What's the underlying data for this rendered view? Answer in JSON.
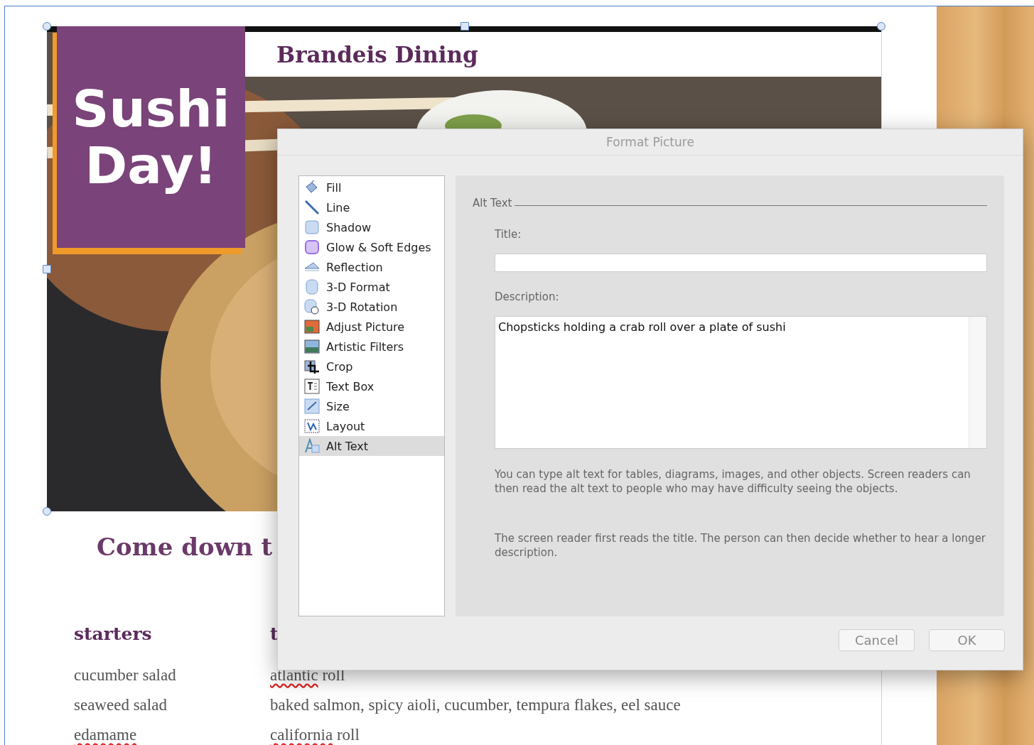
{
  "document": {
    "brand": "Brandeis Dining",
    "badge_lines": [
      "Sushi",
      "Day!"
    ],
    "headline": "Come down t",
    "columns": [
      {
        "heading": "starters",
        "items": [
          [
            {
              "text": "cucumber salad",
              "misspelled": false
            }
          ],
          [
            {
              "text": "seaweed salad",
              "misspelled": false
            }
          ],
          [
            {
              "text": "edamame",
              "misspelled": true
            }
          ]
        ]
      },
      {
        "heading": "t",
        "items": [
          [
            {
              "text": "atlantic",
              "misspelled": true
            },
            {
              "text": " roll",
              "misspelled": false
            }
          ],
          [
            {
              "text": "baked salmon, spicy aioli, cucumber, tempura flakes, eel sauce",
              "misspelled": false
            }
          ],
          [
            {
              "text": "california",
              "misspelled": true
            },
            {
              "text": " roll",
              "misspelled": false
            }
          ]
        ]
      }
    ]
  },
  "dialog": {
    "title": "Format Picture",
    "categories": [
      {
        "label": "Fill",
        "selected": false
      },
      {
        "label": "Line",
        "selected": false
      },
      {
        "label": "Shadow",
        "selected": false
      },
      {
        "label": "Glow & Soft Edges",
        "selected": false
      },
      {
        "label": "Reflection",
        "selected": false
      },
      {
        "label": "3-D Format",
        "selected": false
      },
      {
        "label": "3-D Rotation",
        "selected": false
      },
      {
        "label": "Adjust Picture",
        "selected": false
      },
      {
        "label": "Artistic Filters",
        "selected": false
      },
      {
        "label": "Crop",
        "selected": false
      },
      {
        "label": "Text Box",
        "selected": false
      },
      {
        "label": "Size",
        "selected": false
      },
      {
        "label": "Layout",
        "selected": false
      },
      {
        "label": "Alt Text",
        "selected": true
      }
    ],
    "section_label": "Alt Text",
    "title_label": "Title:",
    "description_label": "Description:",
    "description_value": "Chopsticks holding a crab roll over a plate of sushi",
    "help_texts": [
      "You can type alt text for tables, diagrams, images, and other objects. Screen readers can then read the alt text to people who may have difficulty seeing the objects.",
      "The screen reader first reads the title. The person can then decide whether to hear a longer description."
    ],
    "buttons": [
      "Cancel",
      "OK"
    ]
  }
}
